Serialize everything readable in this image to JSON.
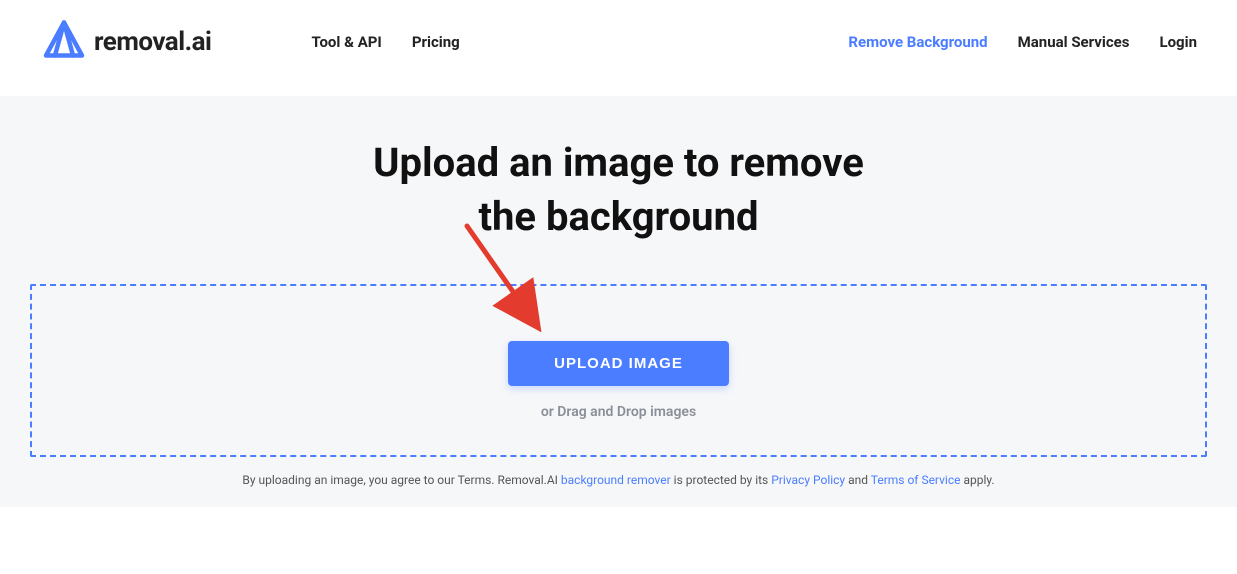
{
  "header": {
    "logo_text": "removal.ai",
    "nav_left": [
      {
        "label": "Tool & API"
      },
      {
        "label": "Pricing"
      }
    ],
    "nav_right": [
      {
        "label": "Remove Background",
        "active": true
      },
      {
        "label": "Manual Services",
        "active": false
      },
      {
        "label": "Login",
        "active": false
      }
    ]
  },
  "main": {
    "headline_line1": "Upload an image to remove",
    "headline_line2": "the background",
    "upload_button": "UPLOAD IMAGE",
    "drag_hint": "or Drag and Drop images",
    "disclaimer_prefix": "By uploading an image, you agree to our Terms. Removal.AI ",
    "disclaimer_link1": "background remover",
    "disclaimer_mid1": " is protected by its ",
    "disclaimer_link2": "Privacy Policy",
    "disclaimer_mid2": " and ",
    "disclaimer_link3": "Terms of Service",
    "disclaimer_suffix": " apply."
  }
}
